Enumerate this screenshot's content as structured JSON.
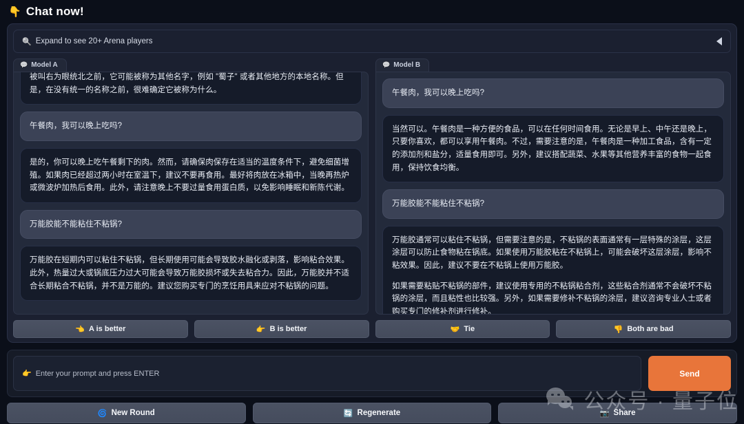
{
  "header": {
    "title": "Chat now!",
    "title_icon": "pointing-down-hand-icon"
  },
  "expand_bar": {
    "label": "Expand to see 20+ Arena players",
    "icon": "magnifier-icon",
    "collapse_icon": "left-triangle-icon"
  },
  "columns": [
    {
      "tab_label": "Model A",
      "messages": [
        {
          "role": "bot",
          "clipped": true,
          "paragraphs": [
            "被叫右为眼统北之前，它可能被称为其他名字，例如 \"蜀子\" 或者其他地方的本地名称。但是，在没有统一的名称之前，很难确定它被称为什么。"
          ]
        },
        {
          "role": "user",
          "paragraphs": [
            "午餐肉，我可以晚上吃吗?"
          ]
        },
        {
          "role": "bot",
          "paragraphs": [
            "是的，你可以晚上吃午餐剩下的肉。然而，请确保肉保存在适当的温度条件下，避免细菌增殖。如果肉已经超过两小时在室温下，建议不要再食用。最好将肉放在冰箱中，当晚再热炉或微波炉加热后食用。此外，请注意晚上不要过量食用蛋白质，以免影响睡眠和新陈代谢。"
          ]
        },
        {
          "role": "user",
          "paragraphs": [
            "万能胶能不能粘住不粘锅?"
          ]
        },
        {
          "role": "bot",
          "paragraphs": [
            "万能胶在短期内可以粘住不粘锅，但长期使用可能会导致胶水融化或剥落，影响粘合效果。此外，热量过大或锅底压力过大可能会导致万能胶损坏或失去粘合力。因此，万能胶并不适合长期粘合不粘锅，并不是万能的。建议您购买专门的烹饪用具来应对不粘锅的问题。"
          ]
        }
      ]
    },
    {
      "tab_label": "Model B",
      "messages": [
        {
          "role": "user",
          "paragraphs": [
            "午餐肉，我可以晚上吃吗?"
          ]
        },
        {
          "role": "bot",
          "paragraphs": [
            "当然可以。午餐肉是一种方便的食品，可以在任何时间食用。无论是早上、中午还是晚上，只要你喜欢，都可以享用午餐肉。不过，需要注意的是，午餐肉是一种加工食品，含有一定的添加剂和盐分，适量食用即可。另外，建议搭配蔬菜、水果等其他营养丰富的食物一起食用，保持饮食均衡。"
          ]
        },
        {
          "role": "user",
          "paragraphs": [
            "万能胶能不能粘住不粘锅?"
          ]
        },
        {
          "role": "bot",
          "paragraphs": [
            "万能胶通常可以粘住不粘锅，但需要注意的是，不粘锅的表面通常有一层特殊的涂层，这层涂层可以防止食物粘在锅底。如果使用万能胶粘在不粘锅上，可能会破坏这层涂层，影响不粘效果。因此，建议不要在不粘锅上使用万能胶。",
            "如果需要粘贴不粘锅的部件，建议使用专用的不粘锅粘合剂，这些粘合剂通常不会破坏不粘锅的涂层，而且粘性也比较强。另外，如果需要修补不粘锅的涂层，建议咨询专业人士或者购买专门的修补剂进行修补。"
          ]
        }
      ]
    }
  ],
  "vote_buttons": [
    {
      "label": "A is better",
      "icon": "pointing-left-hand-icon",
      "glyph": "👈"
    },
    {
      "label": "B is better",
      "icon": "pointing-right-hand-icon",
      "glyph": "👉"
    },
    {
      "label": "Tie",
      "icon": "handshake-icon",
      "glyph": "🤝"
    },
    {
      "label": "Both are bad",
      "icon": "thumbs-down-icon",
      "glyph": "👎"
    }
  ],
  "prompt": {
    "placeholder": "Enter your prompt and press ENTER",
    "value": "",
    "icon": "pointing-right-hand-icon",
    "send_label": "Send",
    "send_color": "#e8753a"
  },
  "actions": [
    {
      "label": "New Round",
      "icon": "recycle-icon",
      "glyph": "🌀"
    },
    {
      "label": "Regenerate",
      "icon": "refresh-icon",
      "glyph": "🔄"
    },
    {
      "label": "Share",
      "icon": "share-icon",
      "glyph": "📷"
    }
  ],
  "watermark": {
    "text": "公众号 · 量子位",
    "logo": "wechat-logo"
  }
}
